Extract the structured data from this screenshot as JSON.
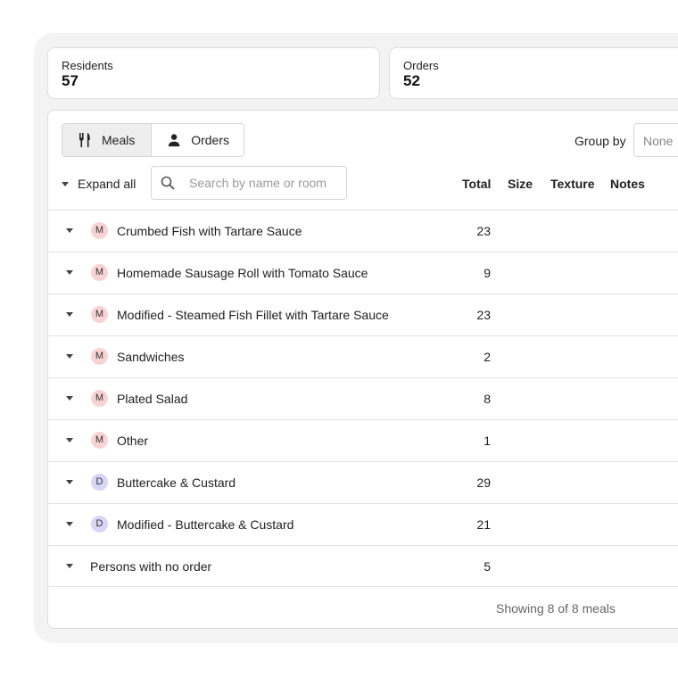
{
  "stats": {
    "residents": {
      "label": "Residents",
      "value": "57"
    },
    "orders": {
      "label": "Orders",
      "value": "52"
    }
  },
  "toolbar": {
    "meals_label": "Meals",
    "orders_label": "Orders",
    "group_by_label": "Group by",
    "group_by_value": "None",
    "expand_all_label": "Expand all",
    "search_placeholder": "Search by name or room"
  },
  "columns": [
    "Total",
    "Size",
    "Texture",
    "Notes"
  ],
  "rows": [
    {
      "badge": "M",
      "name": "Crumbed Fish with Tartare Sauce",
      "total": "23"
    },
    {
      "badge": "M",
      "name": "Homemade Sausage Roll with Tomato Sauce",
      "total": "9"
    },
    {
      "badge": "M",
      "name": "Modified - Steamed Fish Fillet with Tartare Sauce",
      "total": "23"
    },
    {
      "badge": "M",
      "name": "Sandwiches",
      "total": "2"
    },
    {
      "badge": "M",
      "name": "Plated Salad",
      "total": "8"
    },
    {
      "badge": "M",
      "name": "Other",
      "total": "1"
    },
    {
      "badge": "D",
      "name": "Buttercake & Custard",
      "total": "29"
    },
    {
      "badge": "D",
      "name": "Modified - Buttercake & Custard",
      "total": "21"
    },
    {
      "badge": "",
      "name": "Persons with no order",
      "total": "5"
    }
  ],
  "footer": {
    "showing": "Showing 8 of 8 meals"
  },
  "colors": {
    "meal_badge": "#f9d3d3",
    "dessert_badge": "#d8d6f6",
    "background": "#f3f3f3"
  },
  "icons": {
    "meals_tab": "fork-knife-icon",
    "orders_tab": "person-icon",
    "search": "search-icon",
    "row_toggle": "caret-down-icon"
  }
}
